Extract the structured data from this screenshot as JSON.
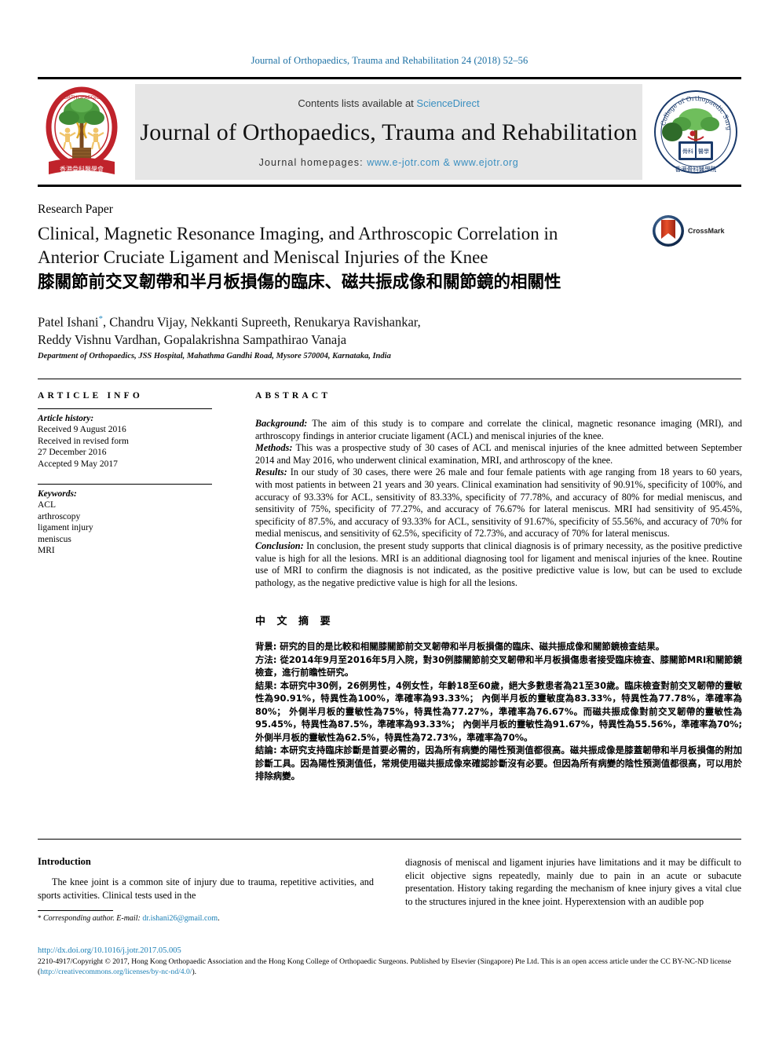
{
  "running_head": "Journal of Orthopaedics, Trauma and Rehabilitation 24 (2018) 52–56",
  "masthead": {
    "contents_prefix": "Contents lists available at ",
    "sciencedirect": "ScienceDirect",
    "journal_title": "Journal of Orthopaedics, Trauma and Rehabilitation",
    "homepage_label": "Journal homepages: ",
    "homepage_links": "www.e-jotr.com & www.ejotr.org",
    "logo_left_name": "hong-kong-orthopaedic-association-logo",
    "logo_right_name": "hong-kong-college-of-orthopaedic-surgeons-logo"
  },
  "article": {
    "type": "Research Paper",
    "title_en_line1": "Clinical, Magnetic Resonance Imaging, and Arthroscopic Correlation in",
    "title_en_line2": "Anterior Cruciate Ligament and Meniscal Injuries of the Knee",
    "title_zh": "膝關節前交叉韌帶和半月板損傷的臨床、磁共振成像和關節鏡的相關性",
    "crossmark_label": "CrossMark",
    "authors_line1": "Patel Ishani",
    "authors_line1_rest": ", Chandru Vijay, Nekkanti Supreeth, Renukarya Ravishankar,",
    "authors_line2": "Reddy Vishnu Vardhan, Gopalakrishna Sampathirao Vanaja",
    "author_marker": "*",
    "affiliation": "Department of Orthopaedics, JSS Hospital, Mahathma Gandhi Road, Mysore 570004, Karnataka, India"
  },
  "article_info": {
    "heading": "ARTICLE INFO",
    "history_label": "Article history:",
    "history_lines": [
      "Received 9 August 2016",
      "Received in revised form",
      "27 December 2016",
      "Accepted 9 May 2017"
    ],
    "keywords_label": "Keywords:",
    "keywords": [
      "ACL",
      "arthroscopy",
      "ligament injury",
      "meniscus",
      "MRI"
    ]
  },
  "abstract": {
    "heading": "ABSTRACT",
    "background_label": "Background:",
    "background_text": " The aim of this study is to compare and correlate the clinical, magnetic resonance imaging (MRI), and arthroscopy findings in anterior cruciate ligament (ACL) and meniscal injuries of the knee.",
    "methods_label": "Methods:",
    "methods_text": " This was a prospective study of 30 cases of ACL and meniscal injuries of the knee admitted between September 2014 and May 2016, who underwent clinical examination, MRI, and arthroscopy of the knee.",
    "results_label": "Results:",
    "results_text": " In our study of 30 cases, there were 26 male and four female patients with age ranging from 18 years to 60 years, with most patients in between 21 years and 30 years. Clinical examination had sensitivity of 90.91%, specificity of 100%, and accuracy of 93.33% for ACL, sensitivity of 83.33%, specificity of 77.78%, and accuracy of 80% for medial meniscus, and sensitivity of 75%, specificity of 77.27%, and accuracy of 76.67% for lateral meniscus. MRI had sensitivity of 95.45%, specificity of 87.5%, and accuracy of 93.33% for ACL, sensitivity of 91.67%, specificity of 55.56%, and accuracy of 70% for medial meniscus, and sensitivity of 62.5%, specificity of 72.73%, and accuracy of 70% for lateral meniscus.",
    "conclusion_label": "Conclusion:",
    "conclusion_text": " In conclusion, the present study supports that clinical diagnosis is of primary necessity, as the positive predictive value is high for all the lesions. MRI is an additional diagnosing tool for ligament and meniscal injuries of the knee. Routine use of MRI to confirm the diagnosis is not indicated, as the positive predictive value is low, but can be used to exclude pathology, as the negative predictive value is high for all the lesions."
  },
  "chinese_abstract": {
    "heading": "中 文 摘 要",
    "background": "背景: 研究的目的是比較和相關膝關節前交叉韌帶和半月板損傷的臨床、磁共振成像和關節鏡檢查結果。",
    "methods": "方法: 從2014年9月至2016年5月入院，對30例膝關節前交叉韌帶和半月板損傷患者接受臨床檢查、膝關節MRI和關節鏡檢查，進行前瞻性研究。",
    "results": "結果: 本研究中30例，26例男性，4例女性，年齡18至60歲，絕大多數患者為21至30歲。臨床檢查對前交叉韌帶的靈敏性為90.91%，特異性為100%，準確率為93.33%； 內側半月板的靈敏度為83.33%，特異性為77.78%，準確率為80%； 外側半月板的靈敏性為75%，特異性為77.27%，準確率為76.67%。而磁共振成像對前交叉韌帶的靈敏性為95.45%，特異性為87.5%，準確率為93.33%； 內側半月板的靈敏性為91.67%，特異性為55.56%，準確率為70%;外側半月板的靈敏性為62.5%，特異性為72.73%，準確率為70%。",
    "conclusion": "結論: 本研究支持臨床診斷是首要必需的，因為所有病變的陽性預測值都很高。磁共振成像是膝蓋韌帶和半月板損傷的附加診斷工具。因為陽性預測值低，常規使用磁共振成像來確認診斷沒有必要。但因為所有病變的陰性預測值都很高，可以用於排除病變。"
  },
  "body": {
    "intro_heading": "Introduction",
    "intro_text": "The knee joint is a common site of injury due to trauma, repetitive activities, and sports activities. Clinical tests used in the",
    "right_col_text": "diagnosis of meniscal and ligament injuries have limitations and it may be difficult to elicit objective signs repeatedly, mainly due to pain in an acute or subacute presentation. History taking regarding the mechanism of knee injury gives a vital clue to the structures injured in the knee joint. Hyperextension with an audible pop"
  },
  "footnote": {
    "marker": "*",
    "text": " Corresponding author. E-mail: ",
    "email": "dr.ishani26@gmail.com",
    "trailing": "."
  },
  "publisher": {
    "doi": "http://dx.doi.org/10.1016/j.jotr.2017.05.005",
    "copyright": "2210-4917/Copyright © 2017, Hong Kong Orthopaedic Association and the Hong Kong College of Orthopaedic Surgeons. Published by Elsevier (Singapore) Pte Ltd. This is an open access article under the CC BY-NC-ND license (",
    "license_url": "http://creativecommons.org/licenses/by-nc-nd/4.0/",
    "copyright_tail": ")."
  },
  "colors": {
    "link": "#1a7fb5",
    "sciencedirect": "#3a8fc0",
    "running_head": "#1a6fa3",
    "masthead_bg": "#e6e6e6"
  }
}
